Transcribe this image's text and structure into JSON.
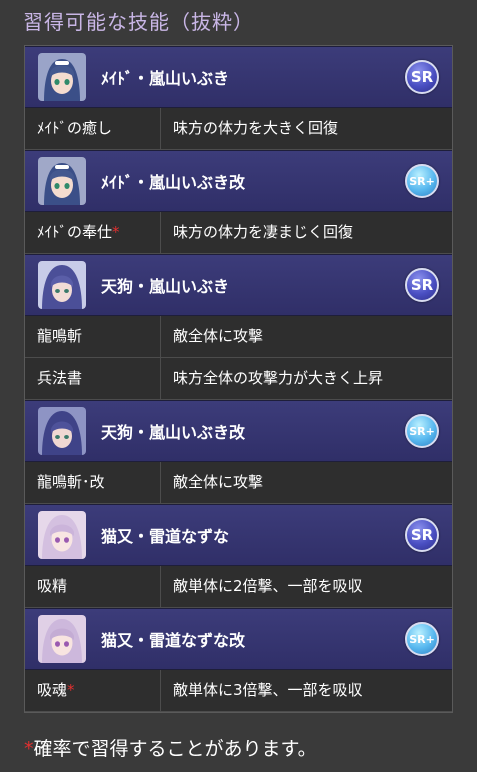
{
  "page": {
    "title": "習得可能な技能（抜粋）",
    "note_mark": "*",
    "note_text": "確率で習得することがあります。"
  },
  "colors": {
    "title": "#c9b6e6",
    "char_row": "#34336e",
    "skill_row": "#2e2e2e",
    "asterisk": "#e03030",
    "rarity_sr": "#4a4fc2",
    "rarity_srplus": "#58b8ef"
  },
  "sections": [
    {
      "character": {
        "name": "ﾒｲﾄﾞ・嵐山いぶき",
        "rarity": "SR",
        "portrait": "character-portrait-icon"
      },
      "skills": [
        {
          "name": "ﾒｲﾄﾞの癒し",
          "mark": "",
          "desc": "味方の体力を大きく回復"
        }
      ]
    },
    {
      "character": {
        "name": "ﾒｲﾄﾞ・嵐山いぶき改",
        "rarity": "SR+",
        "portrait": "character-portrait-icon"
      },
      "skills": [
        {
          "name": "ﾒｲﾄﾞの奉仕",
          "mark": "*",
          "desc": "味方の体力を凄まじく回復"
        }
      ]
    },
    {
      "character": {
        "name": "天狗・嵐山いぶき",
        "rarity": "SR",
        "portrait": "character-portrait-icon"
      },
      "skills": [
        {
          "name": "龍鳴斬",
          "mark": "",
          "desc": "敵全体に攻撃"
        },
        {
          "name": "兵法書",
          "mark": "",
          "desc": "味方全体の攻撃力が大きく上昇"
        }
      ]
    },
    {
      "character": {
        "name": "天狗・嵐山いぶき改",
        "rarity": "SR+",
        "portrait": "character-portrait-icon"
      },
      "skills": [
        {
          "name": "龍鳴斬･改",
          "mark": "",
          "desc": "敵全体に攻撃"
        }
      ]
    },
    {
      "character": {
        "name": "猫又・雷道なずな",
        "rarity": "SR",
        "portrait": "character-portrait-icon"
      },
      "skills": [
        {
          "name": "吸精",
          "mark": "",
          "desc": "敵単体に2倍撃、一部を吸収"
        }
      ]
    },
    {
      "character": {
        "name": "猫又・雷道なずな改",
        "rarity": "SR+",
        "portrait": "character-portrait-icon"
      },
      "skills": [
        {
          "name": "吸魂",
          "mark": "*",
          "desc": "敵単体に3倍撃、一部を吸収"
        }
      ]
    }
  ]
}
